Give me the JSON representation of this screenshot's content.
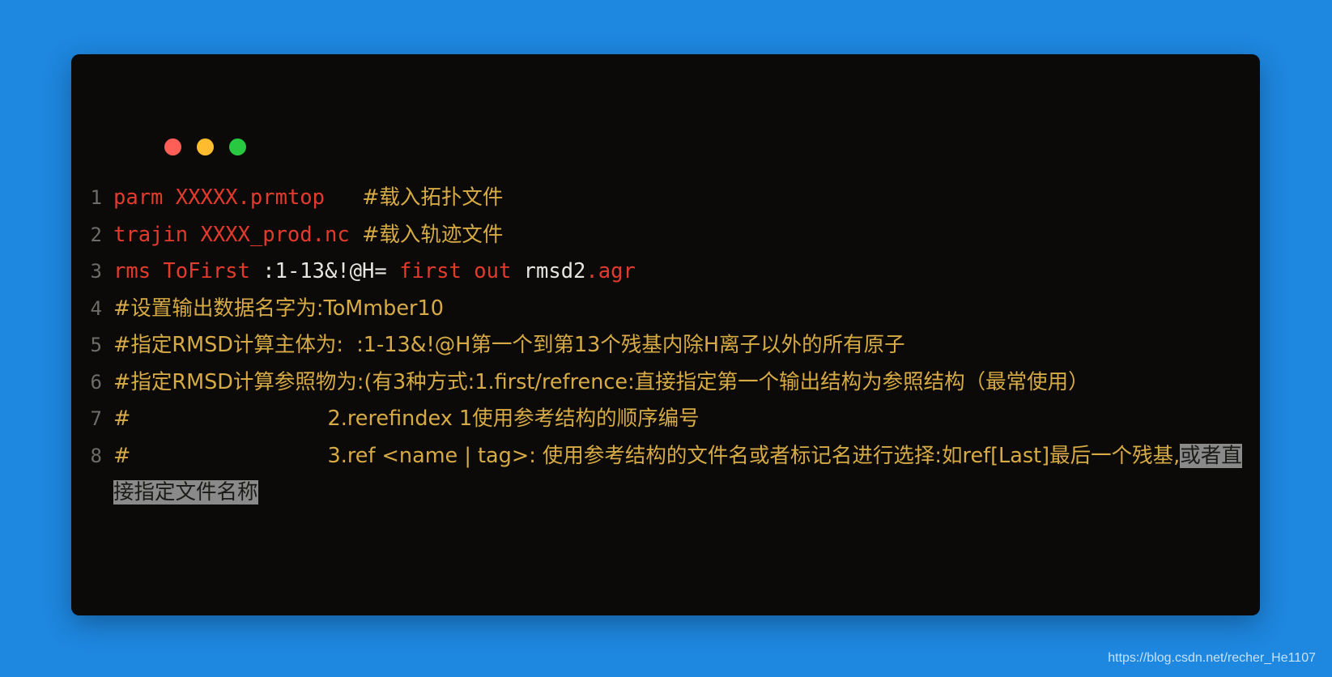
{
  "window": {
    "background_color": "#1e87e0",
    "card_color": "#0c0a08",
    "dots": [
      {
        "name": "close",
        "color": "#ff5f57"
      },
      {
        "name": "minimize",
        "color": "#febc2e"
      },
      {
        "name": "maximize",
        "color": "#28c840"
      }
    ]
  },
  "colors": {
    "keyword_red": "#e23b2e",
    "plain_white": "#e6e6e0",
    "comment_gold": "#d6ab45",
    "line_number": "#6e6c68",
    "selection": "#8a8a8a"
  },
  "code": {
    "lines": [
      {
        "number": "1",
        "plain": "parm XXXXX.prmtop   #载入拓扑文件",
        "tokens": [
          {
            "text": "parm XXXXX",
            "style": "red"
          },
          {
            "text": ".prmtop",
            "style": "red"
          },
          {
            "text": "   ",
            "style": "white"
          },
          {
            "text": "#载入拓扑文件",
            "style": "gold"
          }
        ]
      },
      {
        "number": "2",
        "plain": "trajin XXXX_prod.nc #载入轨迹文件",
        "tokens": [
          {
            "text": "trajin XXXX_prod.nc",
            "style": "red"
          },
          {
            "text": " ",
            "style": "white"
          },
          {
            "text": "#载入轨迹文件",
            "style": "gold"
          }
        ]
      },
      {
        "number": "3",
        "plain": "rms ToFirst :1-13&!@H= first out rmsd2.agr",
        "tokens": [
          {
            "text": "rms ToFirst",
            "style": "red"
          },
          {
            "text": " :1-13&!@H= ",
            "style": "white"
          },
          {
            "text": "first out",
            "style": "red"
          },
          {
            "text": " rmsd2",
            "style": "white"
          },
          {
            "text": ".agr",
            "style": "red"
          }
        ]
      },
      {
        "number": "4",
        "plain": "#设置输出数据名字为:ToMmber10",
        "tokens": [
          {
            "text": "#设置输出数据名字为:ToMmber10",
            "style": "gold"
          }
        ]
      },
      {
        "number": "5",
        "plain": "#指定RMSD计算主体为:  :1-13&!@H第一个到第13个残基内除H离子以外的所有原子",
        "tokens": [
          {
            "text": "#指定RMSD计算主体为:  :1-13&!@H第一个到第13个残基内除H离子以外的所有原子",
            "style": "gold"
          }
        ]
      },
      {
        "number": "6",
        "plain": "#指定RMSD计算参照物为:(有3种方式:1.first/refrence:直接指定第一个输出结构为参照结构（最常使用）",
        "tokens": [
          {
            "text": "#指定RMSD计算参照物为:(有3种方式:1.first/refrence:直接指定第一个输出结构为参照结构（最常使用）",
            "style": "gold"
          }
        ]
      },
      {
        "number": "7",
        "plain": "#                        2.rerefindex 1使用参考结构的顺序编号",
        "tokens": [
          {
            "text": "#                              2.rerefindex 1使用参考结构的顺序编号",
            "style": "gold"
          }
        ]
      },
      {
        "number": "8",
        "plain": "#                        3.ref <name | tag>: 使用参考结构的文件名或者标记名进行选择:如ref[Last]最后一个残基,或者直接指定文件名称",
        "tokens": [
          {
            "text": "#                              3.ref <name | tag>: 使用参考结构的文件名或者标记名进行选择:如ref[Last]最后一个残基,",
            "style": "gold"
          },
          {
            "text": "或者直接指定文件名称",
            "style": "selected"
          }
        ]
      }
    ]
  },
  "watermark": {
    "text": "https://blog.csdn.net/recher_He1107"
  }
}
